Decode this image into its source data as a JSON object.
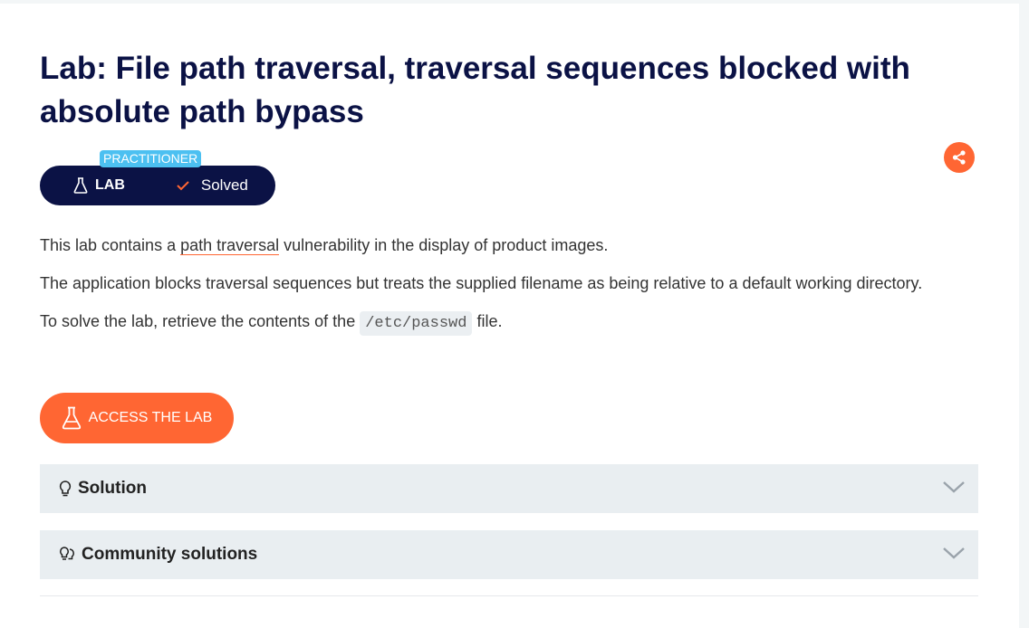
{
  "lab": {
    "title": "Lab: File path traversal, traversal sequences blocked with absolute path bypass",
    "level": "PRACTITIONER",
    "type_label": "LAB",
    "status": "Solved"
  },
  "description": {
    "p1_before": "This lab contains a ",
    "p1_link": "path traversal",
    "p1_after": " vulnerability in the display of product images.",
    "p2": "The application blocks traversal sequences but treats the supplied filename as being relative to a default working directory.",
    "p3_before": "To solve the lab, retrieve the contents of the ",
    "p3_code": "/etc/passwd",
    "p3_after": " file."
  },
  "access_button": "ACCESS THE LAB",
  "accordions": {
    "solution": "Solution",
    "community": "Community solutions"
  },
  "icons": {
    "share": "share-icon",
    "flask": "flask-icon",
    "check": "check-icon",
    "bulb": "lightbulb-icon",
    "community": "community-icon",
    "chevron": "chevron-down-icon"
  },
  "colors": {
    "navy": "#0b1245",
    "accent": "#ff6633",
    "level_blue": "#4cc0f1",
    "accordion_bg": "#e9eef1"
  }
}
